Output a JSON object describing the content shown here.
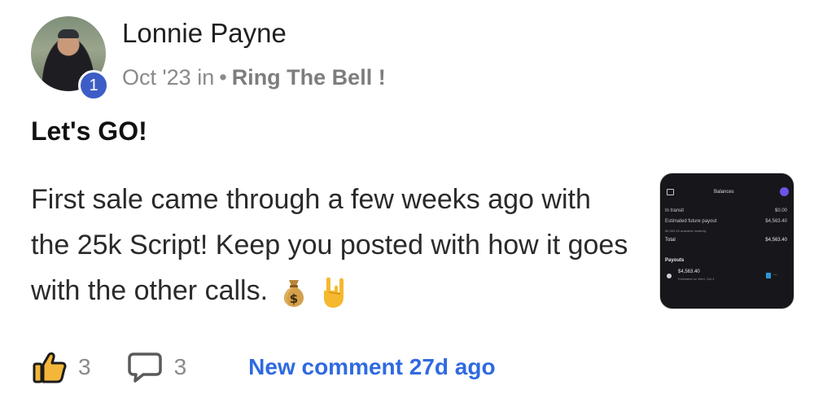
{
  "post": {
    "author_name": "Lonnie Payne",
    "level": "1",
    "date": "Oct '23",
    "in_word": "in",
    "separator": "•",
    "group_name": "Ring The Bell !",
    "title": "Let's GO!",
    "body": "First sale came through a few weeks ago with the 25k Script! Keep you posted with how it goes with the other calls.",
    "body_emojis": [
      "money-bag-icon",
      "sign-of-the-horns-icon"
    ]
  },
  "thumbnail": {
    "header_title": "Balances",
    "rows": [
      {
        "label": "In transit",
        "value": "$0.00"
      },
      {
        "label": "Estimated future payout",
        "value": "$4,563.40"
      },
      {
        "label": "$4,563.40 available instantly",
        "value": ""
      },
      {
        "label": "Total",
        "value": "$4,563.40"
      }
    ],
    "payouts_label": "Payouts",
    "payout_amount": "$4,563.40",
    "payout_note": "Estimated on Wed, Oct 4",
    "payout_more": "..."
  },
  "actions": {
    "likes": "3",
    "comments": "3",
    "new_comment_text": "New comment 27d ago"
  },
  "colors": {
    "badge": "#3d5dc6",
    "link": "#2f6ae0",
    "thumb_bg": "#17171b",
    "accent_purple": "#6b55e8"
  }
}
